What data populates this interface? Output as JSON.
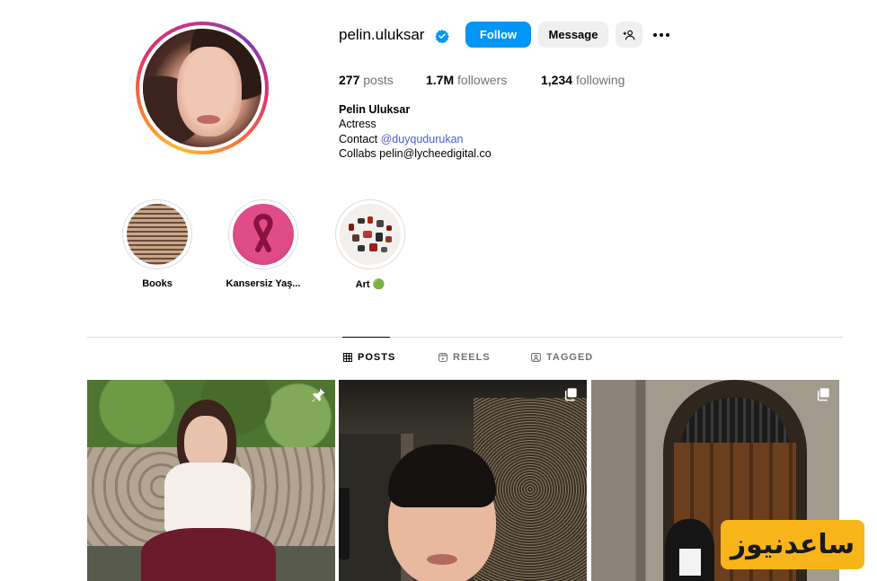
{
  "profile": {
    "username": "pelin.uluksar",
    "verified_icon": "verified-badge-icon",
    "follow_label": "Follow",
    "message_label": "Message",
    "add_user_icon": "person-plus-icon",
    "more_icon": "more-horizontal-icon"
  },
  "stats": {
    "posts_count": "277",
    "posts_label": "posts",
    "followers_count": "1.7M",
    "followers_label": "followers",
    "following_count": "1,234",
    "following_label": "following"
  },
  "bio": {
    "name": "Pelin Uluksar",
    "category": "Actress",
    "contact_prefix": "Contact ",
    "contact_mention": "@duyqudurukan",
    "collabs": "Collabs pelin@lycheedigital.co"
  },
  "highlights": [
    {
      "label": "Books"
    },
    {
      "label": "Kansersiz Yaş..."
    },
    {
      "label": "Art 🟢"
    }
  ],
  "tabs": [
    {
      "label": "POSTS",
      "icon": "grid-icon",
      "active": true
    },
    {
      "label": "REELS",
      "icon": "reels-icon",
      "active": false
    },
    {
      "label": "TAGGED",
      "icon": "tagged-icon",
      "active": false
    }
  ],
  "posts": [
    {
      "badge_icon": "pin-icon"
    },
    {
      "badge_icon": "multiple-images-icon"
    },
    {
      "badge_icon": "multiple-images-icon"
    }
  ],
  "watermark": {
    "text": "ساعدنیوز"
  },
  "colors": {
    "follow_button": "#0095f6",
    "secondary_button": "#efefef",
    "mention_link": "#4a5dd6",
    "muted_text": "#737373",
    "verified": "#0095f6",
    "watermark_bg": "#f8b51a"
  }
}
